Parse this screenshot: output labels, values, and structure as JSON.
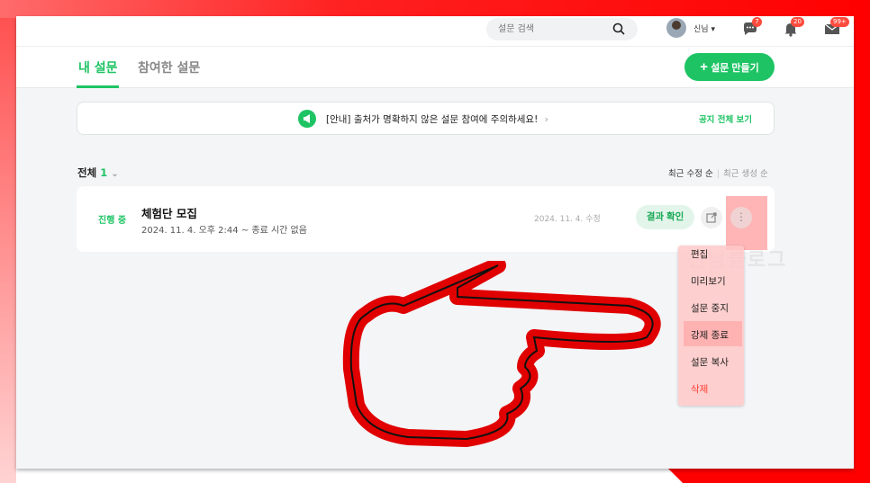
{
  "header": {
    "search_placeholder": "설문 검색",
    "username": "신님",
    "username_caret": "▾",
    "chat_badge": "7",
    "bell_badge": "20",
    "mail_badge": "99+"
  },
  "tabs": [
    {
      "label": "내 설문",
      "active": true
    },
    {
      "label": "참여한 설문",
      "active": false
    }
  ],
  "create_button": "설문 만들기",
  "notice": {
    "text": "[안내] 출처가 명확하지 않은 설문 참여에 주의하세요!",
    "arrow": "›",
    "link": "공지 전체 보기"
  },
  "filter": {
    "label": "전체",
    "count": "1",
    "caret": "⌄",
    "sort_primary": "최근 수정 순",
    "sort_secondary": "최근 생성 순"
  },
  "survey": {
    "status": "진행 중",
    "title": "체험단 모집",
    "subtitle": "2024. 11. 4. 오후 2:44 ~ 종료 시간 없음",
    "modified": "2024. 11. 4. 수정",
    "result_button": "결과 확인",
    "more_icon": "⋮"
  },
  "menu": [
    "편집",
    "미리보기",
    "설문 중지",
    "강제 종료",
    "설문 복사",
    "삭제"
  ],
  "watermark": "신님블로그",
  "colors": {
    "accent": "#1ec464",
    "danger": "#ff3b30",
    "annotation_red": "#ff0000"
  }
}
